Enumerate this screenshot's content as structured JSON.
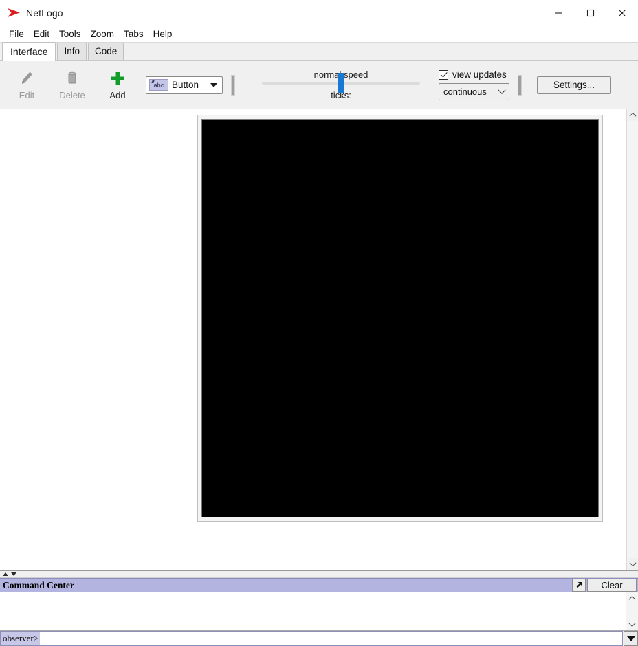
{
  "window": {
    "title": "NetLogo",
    "logo_icon": "netlogo-turtle-arrow-icon",
    "logo_color": "#d81f1f",
    "minimize_label": "—",
    "maximize_label": "□",
    "close_label": "✕"
  },
  "menubar": {
    "items": [
      {
        "label": "File"
      },
      {
        "label": "Edit"
      },
      {
        "label": "Tools"
      },
      {
        "label": "Zoom"
      },
      {
        "label": "Tabs"
      },
      {
        "label": "Help"
      }
    ]
  },
  "tabs": {
    "items": [
      {
        "label": "Interface",
        "active": true
      },
      {
        "label": "Info",
        "active": false
      },
      {
        "label": "Code",
        "active": false
      }
    ]
  },
  "toolbar": {
    "edit": {
      "label": "Edit",
      "icon": "pencil-icon",
      "enabled": false
    },
    "delete": {
      "label": "Delete",
      "icon": "trash-icon",
      "enabled": false
    },
    "add": {
      "label": "Add",
      "icon": "plus-icon",
      "enabled": true,
      "color": "#129c29"
    },
    "widget_select": {
      "value": "Button",
      "badge_text": "abc",
      "badge_color": "#c5c5e8",
      "chevron": "chevron-down-icon"
    },
    "speed": {
      "label": "normal speed",
      "ticks_label": "ticks:",
      "value": 50,
      "min": 0,
      "max": 100,
      "thumb_color": "#1878d2"
    },
    "view_updates": {
      "label": "view updates",
      "checked": true,
      "mode": "continuous",
      "chevron": "chevron-down-icon"
    },
    "settings_label": "Settings..."
  },
  "interface": {
    "world_view": {
      "name": "world-view",
      "background": "#000000",
      "border_color": "#f4f4f4"
    },
    "scrollbar": {
      "up_icon": "chevron-up-icon",
      "down_icon": "chevron-down-icon"
    }
  },
  "splitter": {
    "up_icon": "triangle-up-icon",
    "down_icon": "triangle-down-icon"
  },
  "command_center": {
    "title": "Command Center",
    "title_bar_color": "#b4b4e0",
    "expand_icon": "expand-diagonal-icon",
    "clear_label": "Clear",
    "output_text": "",
    "prompt": "observer>",
    "input_value": "",
    "history_icon": "triangle-down-icon",
    "scrollbar": {
      "up_icon": "chevron-up-icon",
      "down_icon": "chevron-down-icon"
    }
  }
}
